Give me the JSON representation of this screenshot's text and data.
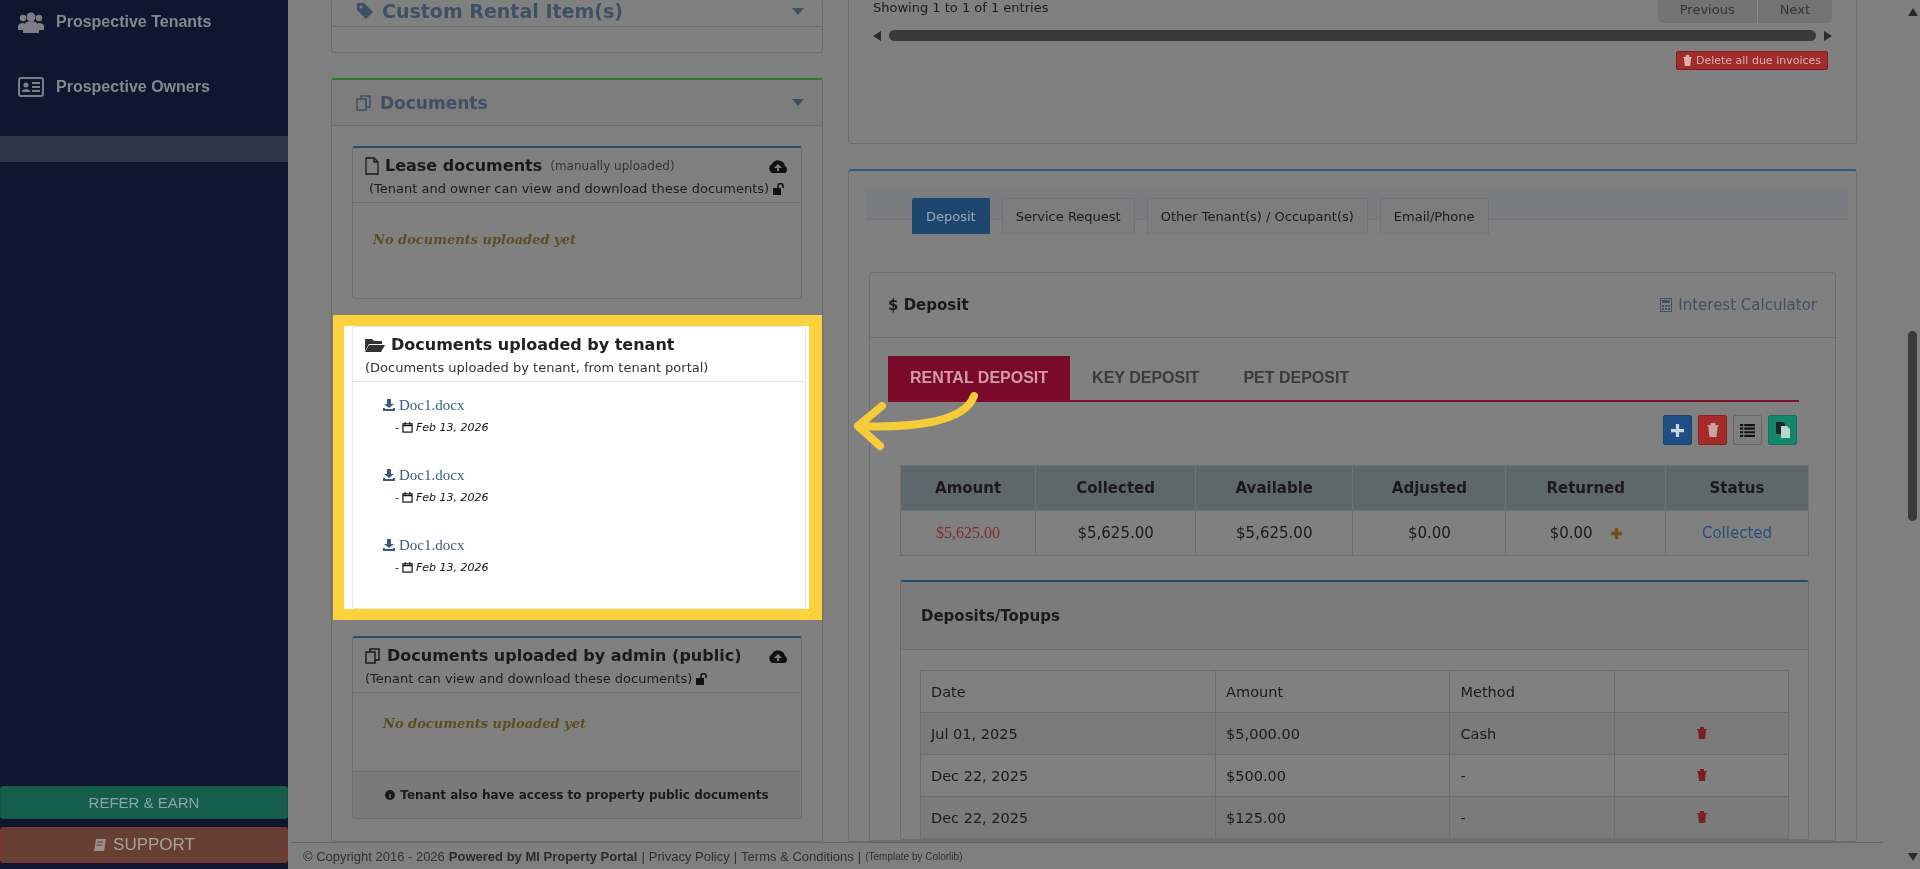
{
  "sidebar": {
    "items": [
      {
        "label": "Prospective Tenants",
        "kind": "people"
      },
      {
        "label": "Prospective Owners",
        "kind": "card"
      }
    ],
    "refer_button": "REFER & EARN",
    "support_button": "SUPPORT"
  },
  "custom_rental_items": {
    "title": "Custom Rental Item(s)"
  },
  "documents": {
    "title": "Documents",
    "sections": [
      {
        "kind": "lease",
        "title": "Lease documents",
        "subtitle": "(manually uploaded)",
        "note": "(Tenant and owner can view and download these documents)",
        "locked": false,
        "upload": true,
        "highlighted": false,
        "empty_text": "No documents uploaded yet"
      },
      {
        "kind": "tenant",
        "title": "Documents uploaded by tenant",
        "note": "(Documents uploaded by tenant, from tenant portal)",
        "upload": false,
        "highlighted": true,
        "files": [
          {
            "name": "Doc1.docx",
            "separator": "-",
            "date": "Feb 13, 2026"
          },
          {
            "name": "Doc1.docx",
            "separator": "-",
            "date": "Feb 13, 2026"
          },
          {
            "name": "Doc1.docx",
            "separator": "-",
            "date": "Feb 13, 2026"
          }
        ]
      },
      {
        "kind": "admin",
        "title": "Documents uploaded by admin (public)",
        "note": "(Tenant can view and download these documents)",
        "locked": false,
        "upload": true,
        "highlighted": false,
        "empty_text": "No documents uploaded yet",
        "footnote": "Tenant also have access to property public documents"
      }
    ]
  },
  "invoices": {
    "showing": "Showing 1 to 1 of 1 entries",
    "pager": [
      {
        "label": "Previous",
        "disabled": true
      },
      {
        "label": "Next",
        "disabled": true
      }
    ],
    "delete_button": "Delete all due invoices"
  },
  "tabs": [
    {
      "label": "Deposit",
      "selected": true
    },
    {
      "label": "Service Request",
      "selected": false
    },
    {
      "label": "Other Tenant(s) / Occupant(s)",
      "selected": false
    },
    {
      "label": "Email/Phone",
      "selected": false
    }
  ],
  "deposit": {
    "title": "$ Deposit",
    "interest_calculator": "Interest Calculator",
    "subtabs": [
      {
        "label": "RENTAL DEPOSIT",
        "selected": true
      },
      {
        "label": "KEY DEPOSIT",
        "selected": false
      },
      {
        "label": "PET DEPOSIT",
        "selected": false
      }
    ],
    "summary": {
      "columns": [
        "Amount",
        "Collected",
        "Available",
        "Adjusted",
        "Returned",
        "Status"
      ],
      "row": [
        "$5,625.00",
        "$5,625.00",
        "$5,625.00",
        "$0.00",
        "$0.00",
        "Collected"
      ]
    },
    "topups": {
      "title": "Deposits/Topups",
      "columns": [
        "Date",
        "Amount",
        "Method"
      ],
      "rows": [
        [
          "Jul 01, 2025",
          "$5,000.00",
          "Cash"
        ],
        [
          "Dec 22, 2025",
          "$500.00",
          "-"
        ],
        [
          "Dec 22, 2025",
          "$125.00",
          "-"
        ]
      ]
    }
  },
  "footer": {
    "copyright": "© Copyright 2016 - 2026",
    "powered": "Powered by MI Property Portal",
    "separator": "|",
    "links": [
      "Privacy Policy",
      "Terms & Conditions"
    ],
    "template": "(Template by Colorlib)"
  }
}
